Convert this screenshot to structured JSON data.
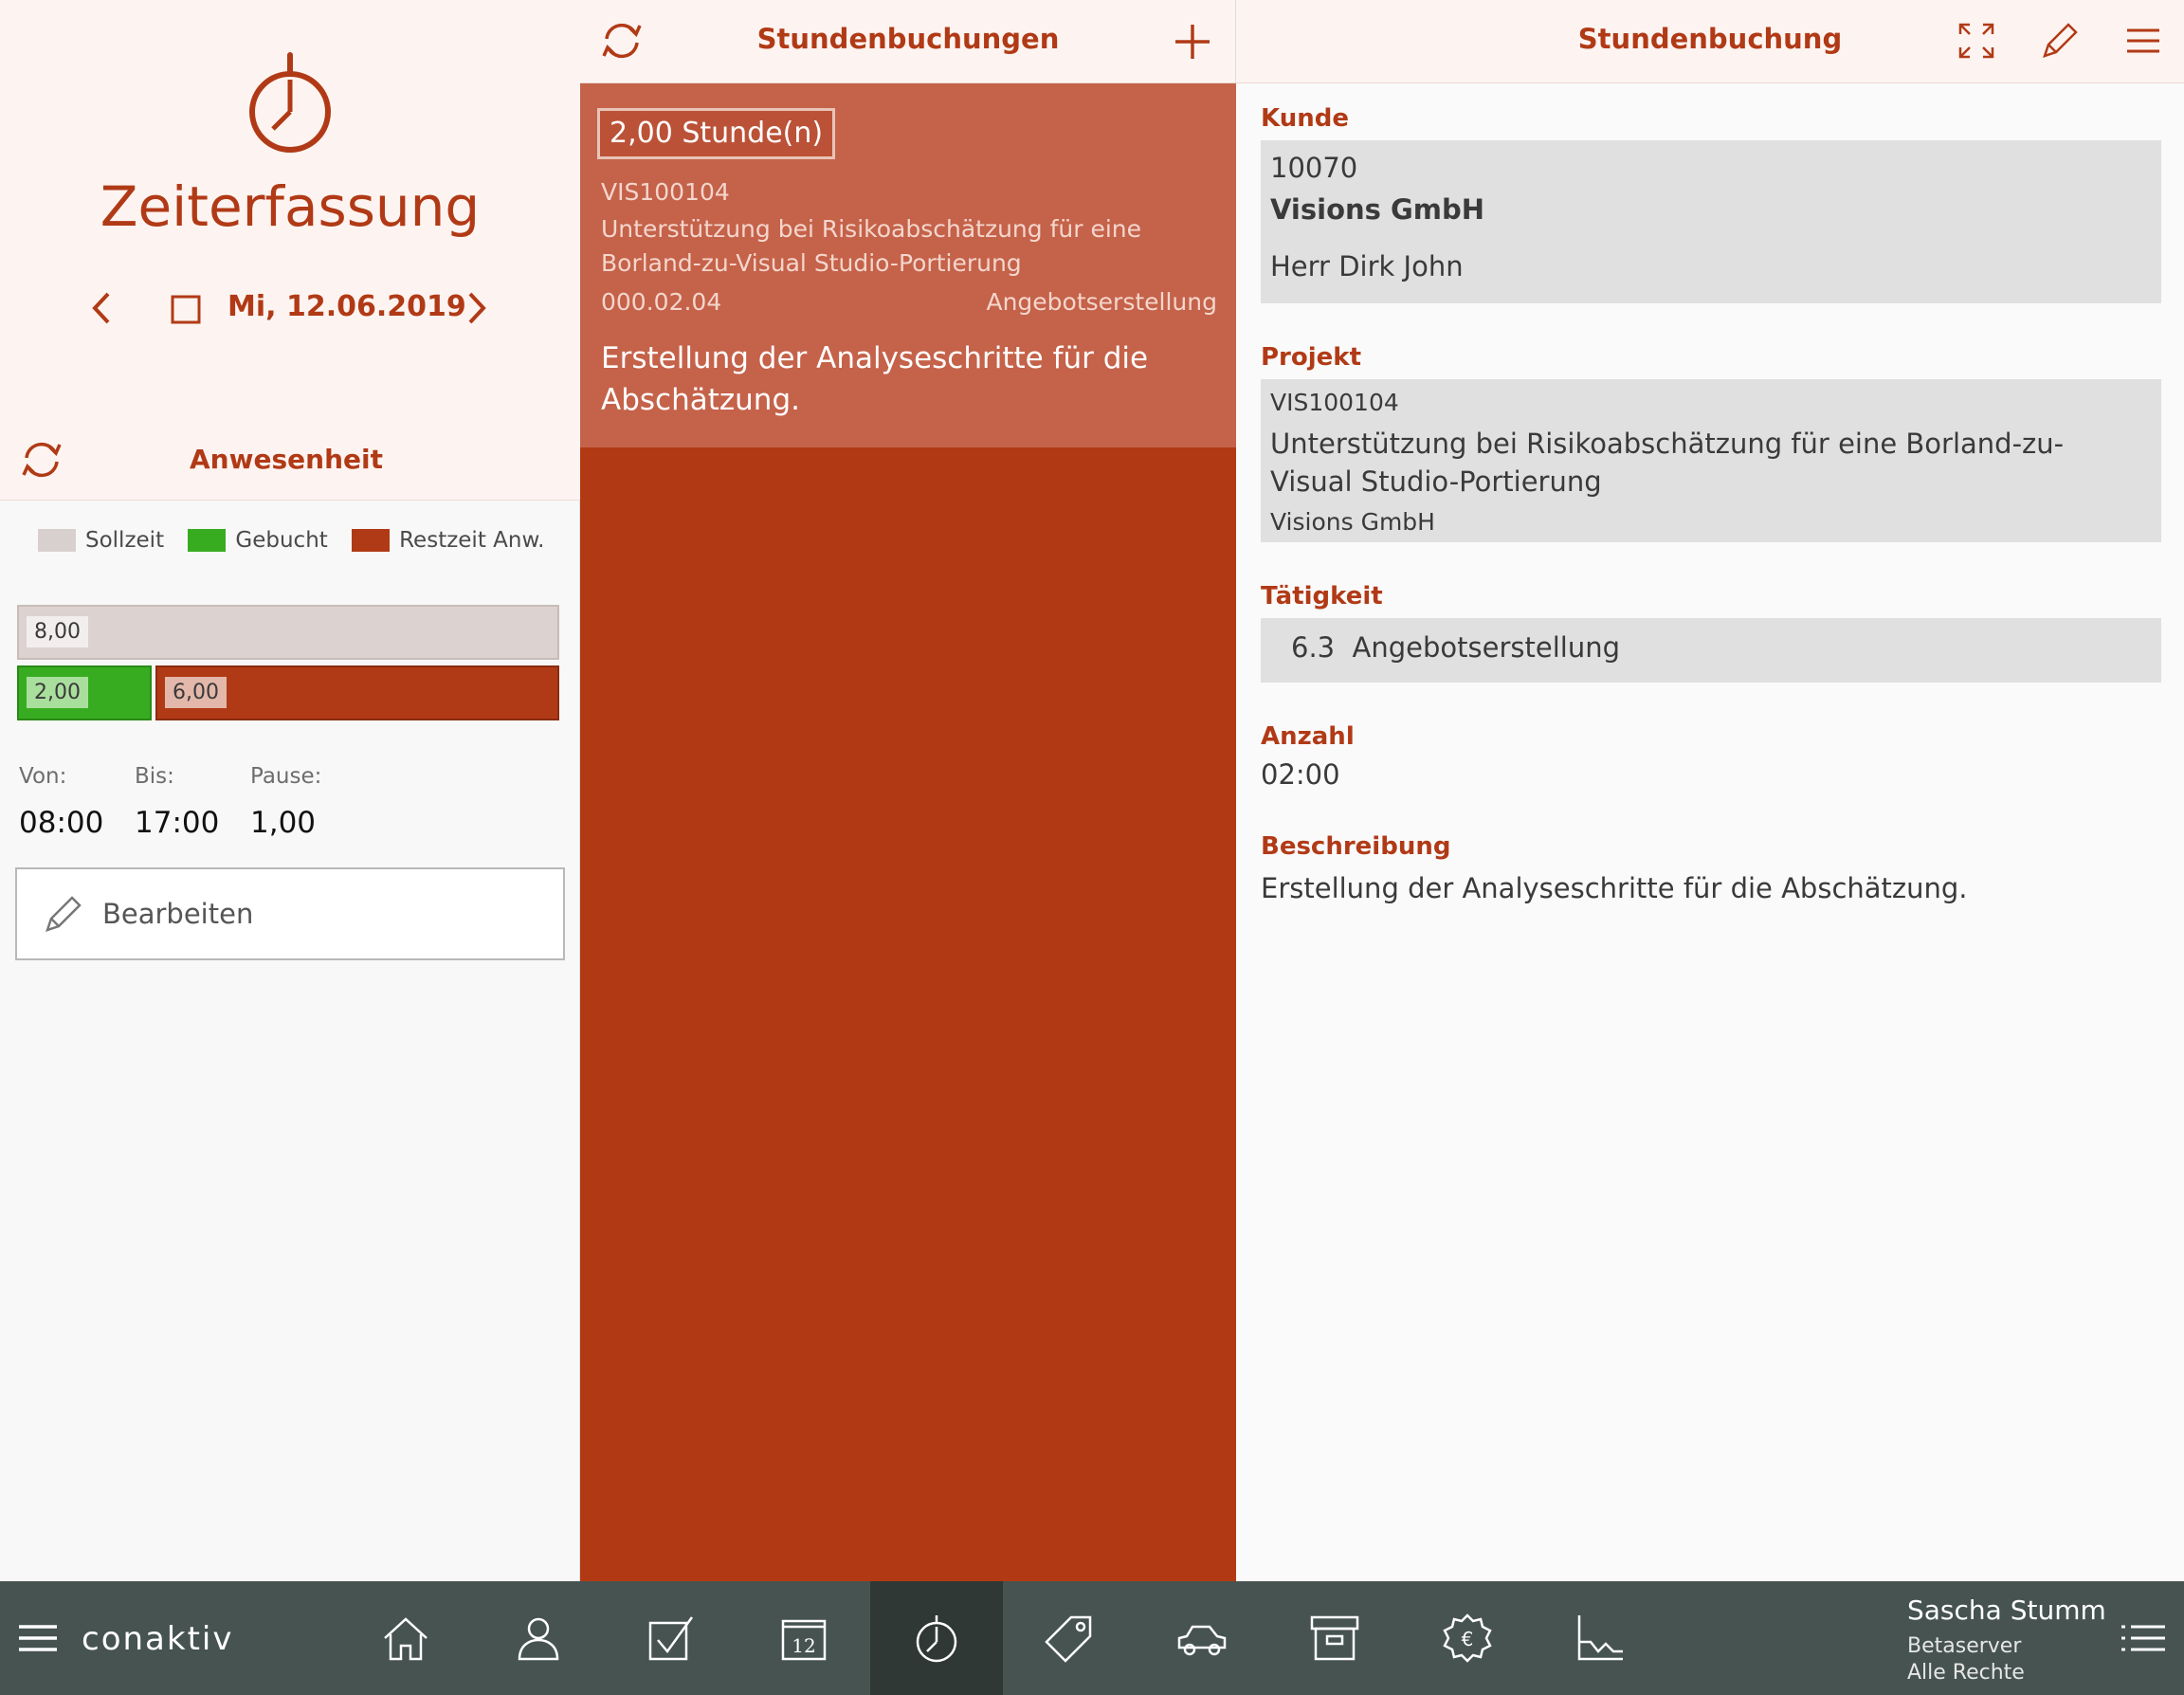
{
  "left": {
    "app_title": "Zeiterfassung",
    "date": "Mi, 12.06.2019",
    "presence_title": "Anwesenheit",
    "legend": [
      {
        "label": "Sollzeit",
        "color": "#d8d0ce"
      },
      {
        "label": "Gebucht",
        "color": "#37ac20"
      },
      {
        "label": "Restzeit Anw.",
        "color": "#b03a15"
      }
    ],
    "bars": {
      "target": 8.0,
      "target_label": "8,00",
      "booked": 2.0,
      "booked_label": "2,00",
      "remaining": 6.0,
      "remaining_label": "6,00"
    },
    "times": {
      "from_label": "Von:",
      "from_value": "08:00",
      "to_label": "Bis:",
      "to_value": "17:00",
      "pause_label": "Pause:",
      "pause_value": "1,00"
    },
    "edit_label": "Bearbeiten"
  },
  "middle": {
    "title": "Stundenbuchungen",
    "entry": {
      "hours": "2,00 Stunde(n)",
      "project_code": "VIS100104",
      "project_name": "Unterstützung bei Risikoabschätzung für eine Borland-zu-Visual Studio-Portierung",
      "number": "000.02.04",
      "activity": "Angebotserstellung",
      "description": "Erstellung der Analyseschritte für die Abschätzung."
    }
  },
  "right": {
    "title": "Stundenbuchung",
    "customer_label": "Kunde",
    "customer_number": "10070",
    "customer_name": "Visions GmbH",
    "customer_contact": "Herr Dirk John",
    "project_label": "Projekt",
    "project_code": "VIS100104",
    "project_name": "Unterstützung bei Risikoabschätzung für eine Borland-zu-Visual Studio-Portierung",
    "project_customer": "Visions GmbH",
    "activity_label": "Tätigkeit",
    "activity_value": "6.3  Angebotserstellung",
    "count_label": "Anzahl",
    "count_value": "02:00",
    "description_label": "Beschreibung",
    "description_value": "Erstellung der Analyseschritte für die Abschätzung."
  },
  "bottom": {
    "logo_text": "conaktiv",
    "nav_items": [
      "home-icon",
      "contacts-icon",
      "tasks-icon",
      "calendar-icon",
      "timer-icon",
      "tag-icon",
      "car-icon",
      "archive-icon",
      "billing-icon",
      "chart-icon"
    ],
    "active_item": "timer-icon",
    "calendar_day": "12",
    "user_name": "Sascha Stumm",
    "server": "Betaserver",
    "rights": "Alle Rechte"
  },
  "colors": {
    "accent": "#b13a16",
    "entry_bg": "#c5624a",
    "panel_bg": "#b13a14",
    "header_bg": "#fdf4f1",
    "bottom_bg": "#465350"
  }
}
